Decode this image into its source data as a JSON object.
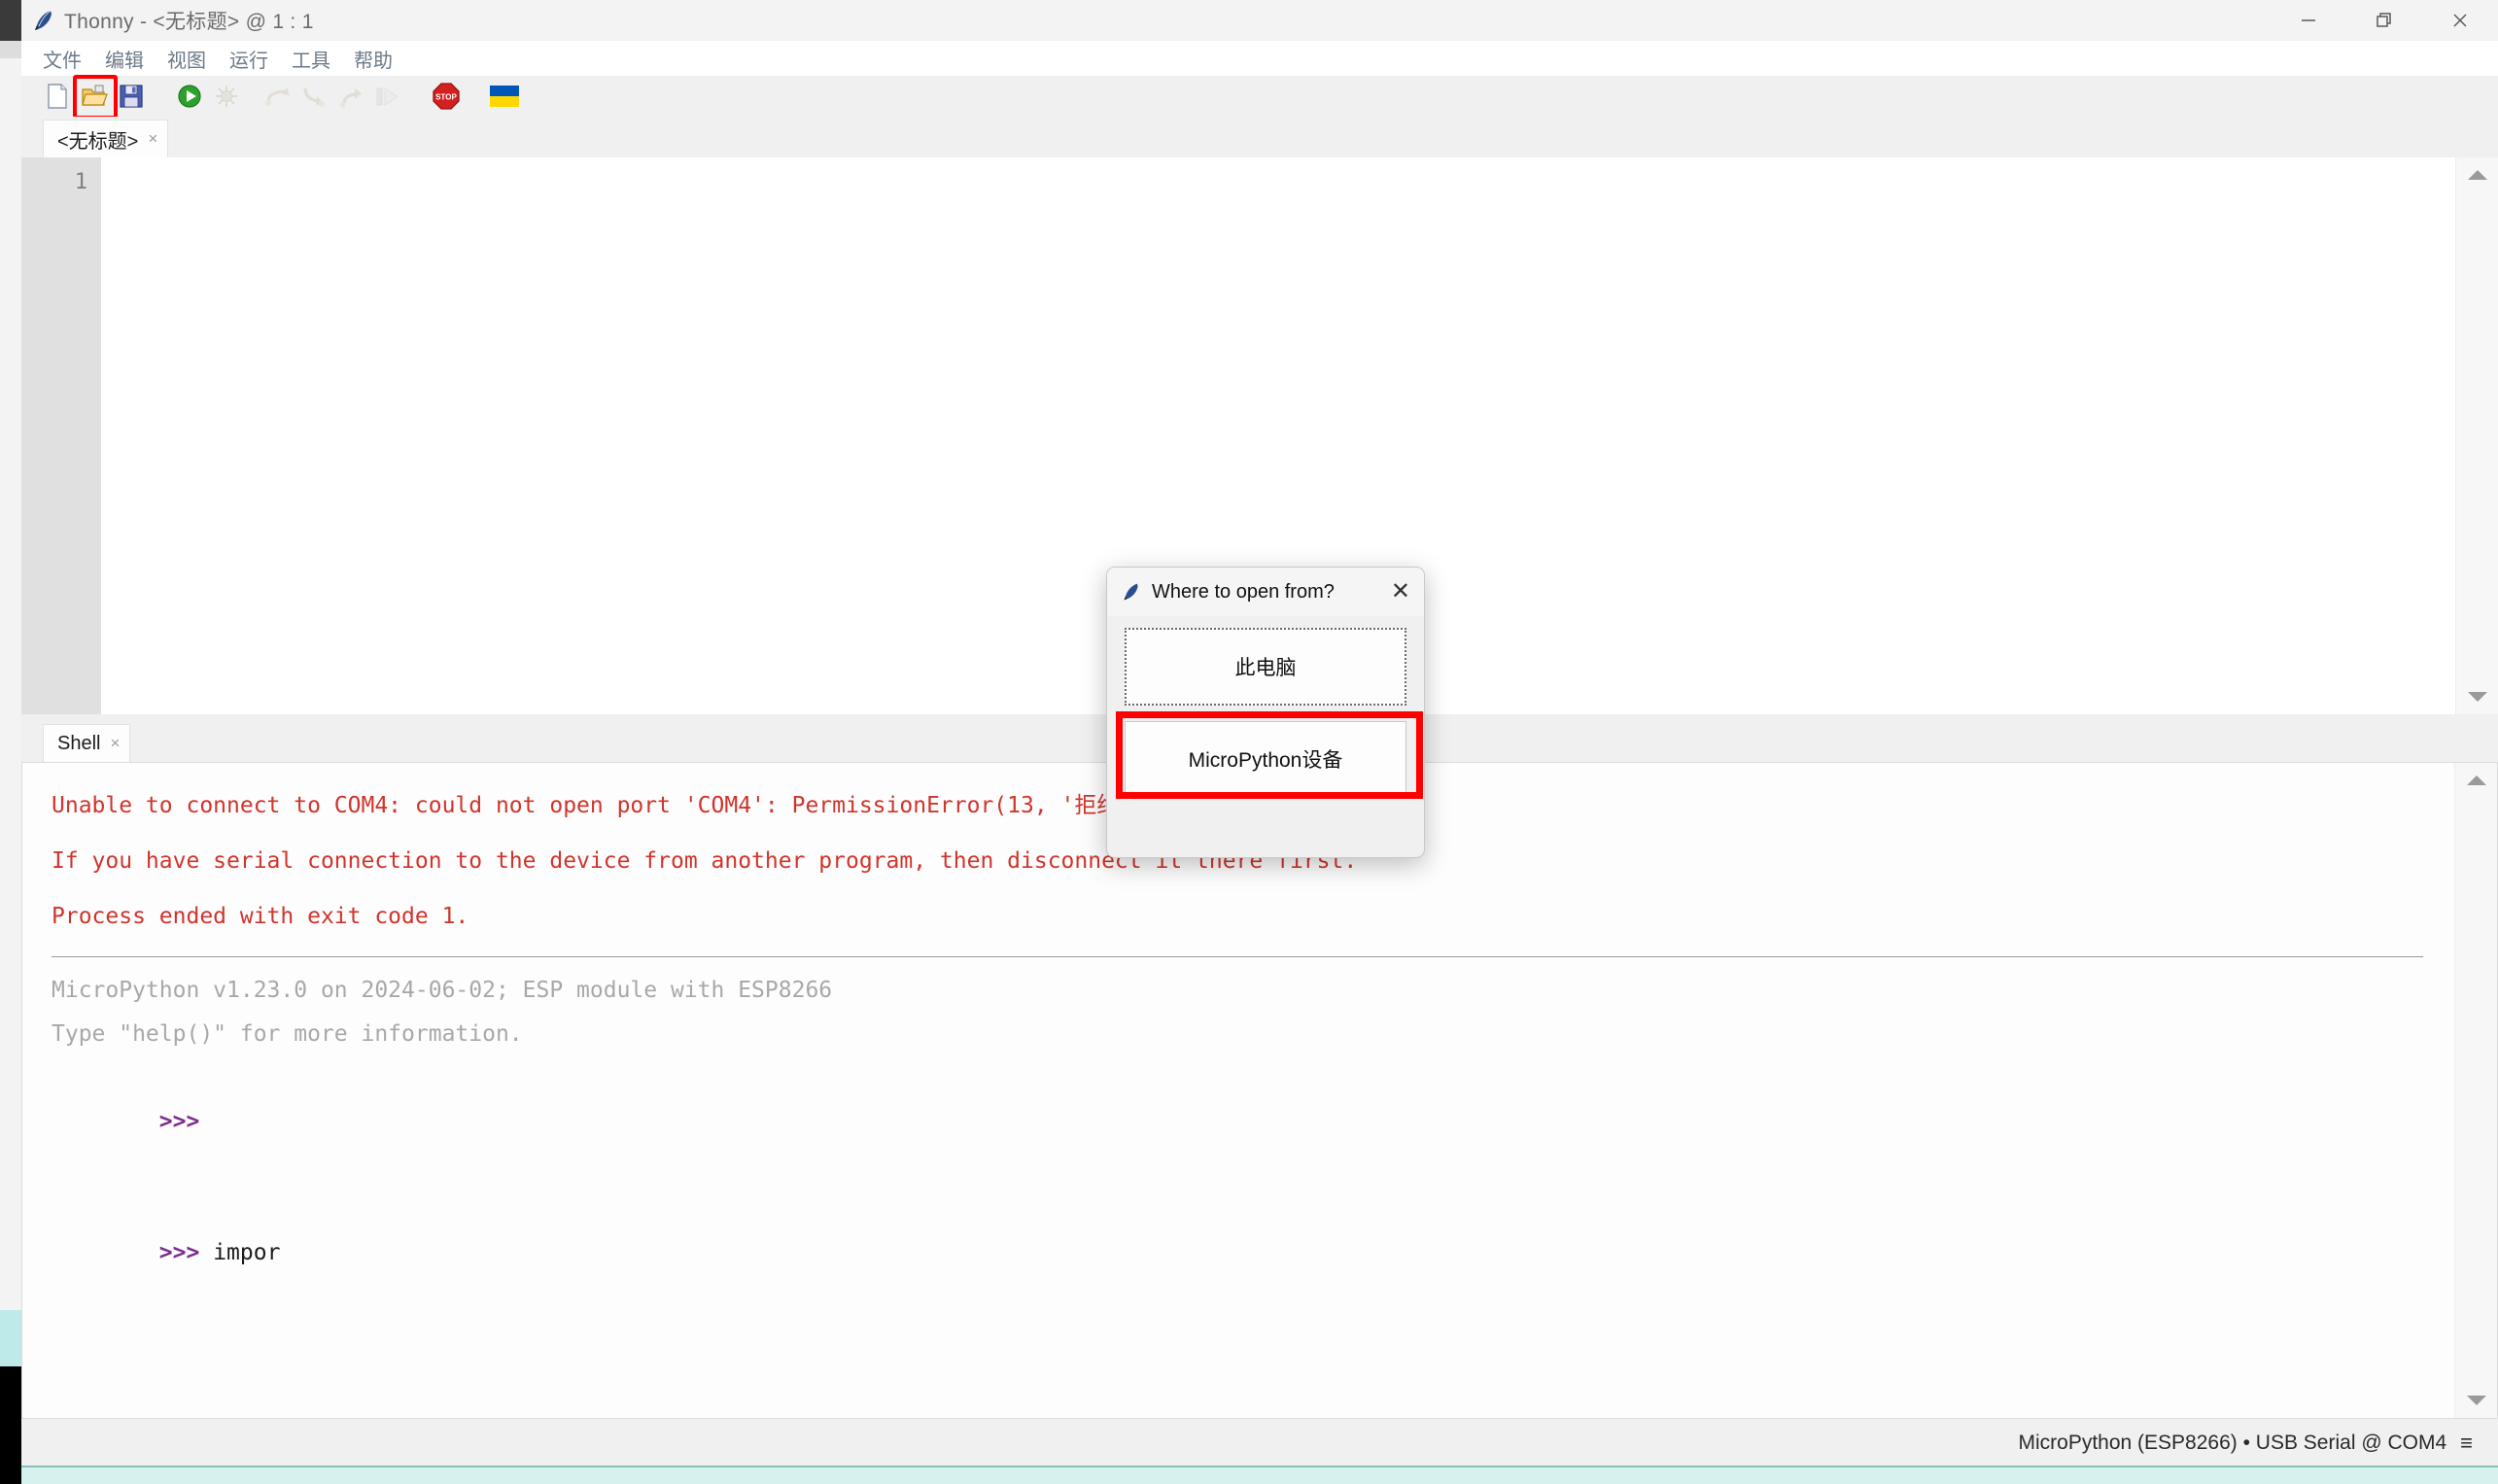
{
  "window": {
    "app_name": "Thonny",
    "title": "Thonny  -  <无标题>  @  1 : 1",
    "icon": "thonny-feather-icon",
    "controls": {
      "minimize": "—",
      "restore": "❐",
      "close": "✕"
    }
  },
  "menubar": {
    "items": [
      {
        "label": "文件",
        "name": "menu-file"
      },
      {
        "label": "编辑",
        "name": "menu-edit"
      },
      {
        "label": "视图",
        "name": "menu-view"
      },
      {
        "label": "运行",
        "name": "menu-run"
      },
      {
        "label": "工具",
        "name": "menu-tools"
      },
      {
        "label": "帮助",
        "name": "menu-help"
      }
    ]
  },
  "toolbar": {
    "buttons": [
      {
        "name": "new-file-button",
        "icon": "new-document-icon",
        "state": "enabled",
        "highlighted": false
      },
      {
        "name": "open-file-button",
        "icon": "open-folder-icon",
        "state": "enabled",
        "highlighted": true
      },
      {
        "name": "save-file-button",
        "icon": "floppy-disk-save-icon",
        "state": "enabled",
        "highlighted": false
      },
      {
        "name": "run-button",
        "icon": "run-play-icon",
        "state": "enabled",
        "highlighted": false
      },
      {
        "name": "debug-button",
        "icon": "debug-bug-icon",
        "state": "disabled",
        "highlighted": false
      },
      {
        "name": "step-over-button",
        "icon": "step-over-arrow-icon",
        "state": "disabled",
        "highlighted": false
      },
      {
        "name": "step-into-button",
        "icon": "step-into-arrow-icon",
        "state": "disabled",
        "highlighted": false
      },
      {
        "name": "step-out-button",
        "icon": "step-out-arrow-icon",
        "state": "disabled",
        "highlighted": false
      },
      {
        "name": "resume-button",
        "icon": "resume-play-icon",
        "state": "disabled",
        "highlighted": false
      },
      {
        "name": "stop-button",
        "icon": "stop-sign-icon",
        "state": "enabled",
        "highlighted": false
      },
      {
        "name": "ukraine-flag-button",
        "icon": "ukraine-flag-icon",
        "state": "enabled",
        "highlighted": false
      }
    ],
    "highlight_color": "#ff0000"
  },
  "editor": {
    "tab": {
      "label": "<无标题>",
      "close_glyph": "×"
    },
    "line_numbers": [
      "1"
    ],
    "content": ""
  },
  "shell": {
    "tab": {
      "label": "Shell",
      "close_glyph": "×"
    },
    "error_lines": [
      "Unable to connect to COM4: could not open port 'COM4': PermissionError(13, '拒绝访问。', None, 5)",
      "If you have serial connection to the device from another program, then disconnect it there first.",
      "Process ended with exit code 1."
    ],
    "info_lines": [
      "MicroPython v1.23.0 on 2024-06-02; ESP module with ESP8266",
      "Type \"help()\" for more information."
    ],
    "prompt": ">>>",
    "prompt_empty": ">>>",
    "current_input": "impor",
    "error_color": "#d0342c",
    "info_color": "#a8a8a8",
    "prompt_color": "#7b2d8e"
  },
  "dialog": {
    "icon": "thonny-feather-icon",
    "title": "Where to open from?",
    "close_glyph": "✕",
    "options": [
      {
        "label": "此电脑",
        "name": "dialog-option-this-computer",
        "highlighted": false
      },
      {
        "label": "MicroPython设备",
        "name": "dialog-option-micropython-device",
        "highlighted": true
      }
    ],
    "highlight_color": "#ff0000"
  },
  "statusbar": {
    "text": "MicroPython (ESP8266)  •  USB Serial @ COM4",
    "menu_glyph": "≡"
  }
}
